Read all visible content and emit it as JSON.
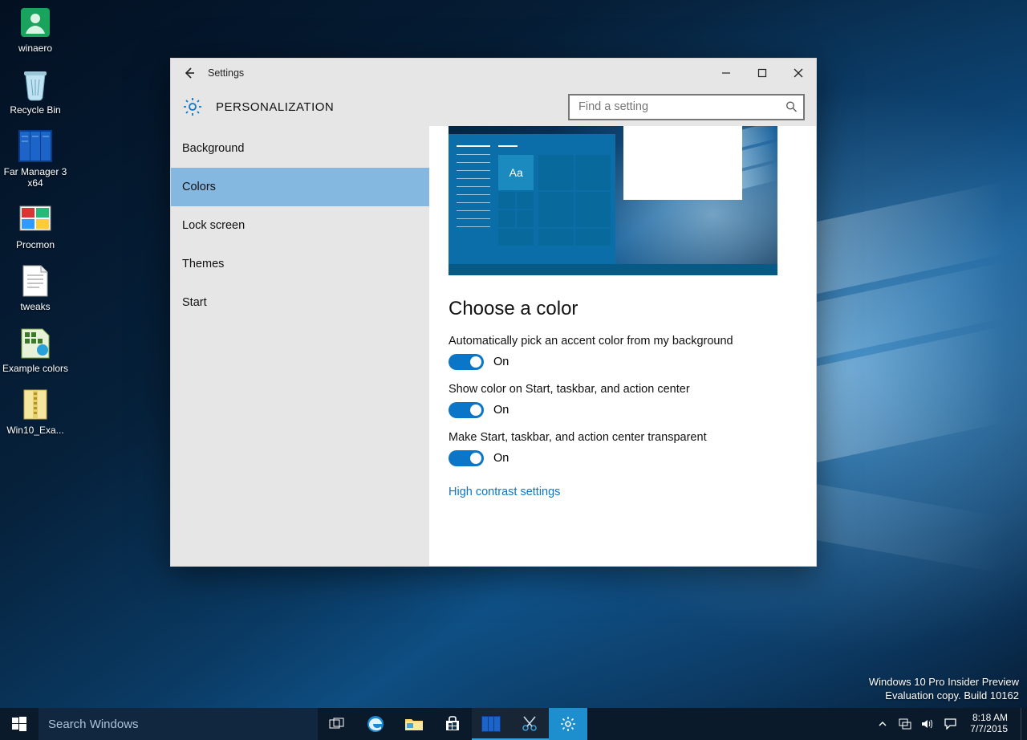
{
  "desktop_icons": [
    {
      "label": "winaero"
    },
    {
      "label": "Recycle Bin"
    },
    {
      "label": "Far Manager 3 x64"
    },
    {
      "label": "Procmon"
    },
    {
      "label": "tweaks"
    },
    {
      "label": "Example colors"
    },
    {
      "label": "Win10_Exa..."
    }
  ],
  "window": {
    "title": "Settings",
    "category": "PERSONALIZATION",
    "search_placeholder": "Find a setting",
    "sidebar": [
      {
        "label": "Background"
      },
      {
        "label": "Colors"
      },
      {
        "label": "Lock screen"
      },
      {
        "label": "Themes"
      },
      {
        "label": "Start"
      }
    ],
    "pane": {
      "preview_accent_text": "Aa",
      "heading": "Choose a color",
      "options": [
        {
          "label": "Automatically pick an accent color from my background",
          "state": "On"
        },
        {
          "label": "Show color on Start, taskbar, and action center",
          "state": "On"
        },
        {
          "label": "Make Start, taskbar, and action center transparent",
          "state": "On"
        }
      ],
      "link": "High contrast settings"
    }
  },
  "watermark": {
    "line1": "Windows 10 Pro Insider Preview",
    "line2": "Evaluation copy. Build 10162"
  },
  "taskbar": {
    "search_placeholder": "Search Windows",
    "time": "8:18 AM",
    "date": "7/7/2015"
  }
}
